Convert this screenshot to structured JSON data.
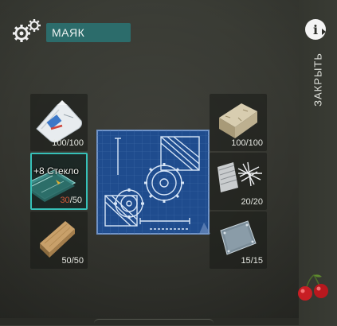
{
  "header": {
    "title": "МАЯК",
    "settings_icon": "gears-icon"
  },
  "side": {
    "info_label": "i",
    "close_label": "ЗАКРЫТЬ"
  },
  "resources": {
    "left": [
      {
        "name": "cement-bag",
        "current": "100",
        "required": "100"
      },
      {
        "name": "glass",
        "current": "30",
        "required": "50",
        "bonus": "+8 Стекло"
      },
      {
        "name": "wood-plank",
        "current": "50",
        "required": "50"
      }
    ],
    "right": [
      {
        "name": "stone-block",
        "current": "100",
        "required": "100"
      },
      {
        "name": "metal-wire",
        "current": "20",
        "required": "20"
      },
      {
        "name": "steel-plate",
        "current": "15",
        "required": "15"
      }
    ]
  },
  "colors": {
    "accent": "#2c6c6b",
    "selection": "#36c0b8",
    "shortage": "#d45a3a"
  }
}
